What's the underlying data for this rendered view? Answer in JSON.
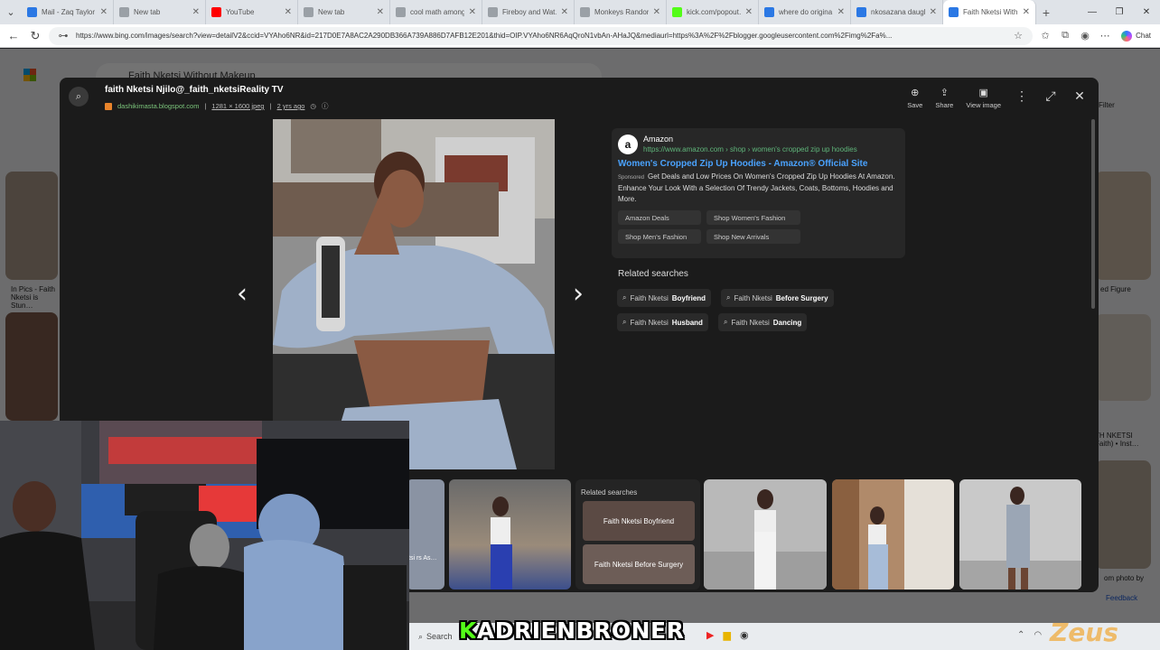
{
  "browser": {
    "tabs": [
      {
        "title": "Mail - Zaq Taylor",
        "color": "#2b78e4",
        "active": false
      },
      {
        "title": "New tab",
        "color": "#9aa0a6",
        "active": false
      },
      {
        "title": "YouTube",
        "color": "#ff0000",
        "active": false
      },
      {
        "title": "New tab",
        "color": "#9aa0a6",
        "active": false
      },
      {
        "title": "cool math among",
        "color": "#9aa0a6",
        "active": false
      },
      {
        "title": "Fireboy and Wat…",
        "color": "#9aa0a6",
        "active": false
      },
      {
        "title": "Monkeys Randon…",
        "color": "#9aa0a6",
        "active": false
      },
      {
        "title": "kick.com/popout…",
        "color": "#53fc18",
        "active": false
      },
      {
        "title": "where do origina…",
        "color": "#2b78e4",
        "active": false
      },
      {
        "title": "nkosazana daugh…",
        "color": "#2b78e4",
        "active": false
      },
      {
        "title": "Faith Nketsi With…",
        "color": "#2b78e4",
        "active": true
      }
    ],
    "url": "https://www.bing.com/images/search?view=detailV2&ccid=VYAho6NR&id=217D0E7A8AC2A290DB366A739A886D7AFB12E201&thid=OIP.VYAho6NR6AqQroN1vbAn-AHaJQ&mediaurl=https%3A%2F%2Fblogger.googleusercontent.com%2Fimg%2Fa%...",
    "chat_label": "Chat"
  },
  "background_page": {
    "search_query": "Faith Nketsi Without Makeup",
    "left_caption": "In Pics - Faith Nketsi is Stun…",
    "right_caption_1": "ed Figure",
    "right_caption_2": "TH NKETSI Faith) • Inst…",
    "right_caption_3": "om photo by",
    "feedback": "Feedback",
    "filter": "Filter"
  },
  "viewer": {
    "title": "faith Nketsi Njilo@_faith_nketsiReality TV",
    "source": "dashikimasta.blogspot.com",
    "dimensions": "1281 × 1600 jpeg",
    "age": "2 yrs ago",
    "actions": {
      "save": "Save",
      "share": "Share",
      "view_image": "View image"
    }
  },
  "ad": {
    "brand": "Amazon",
    "url": "https://www.amazon.com › shop › women's cropped zip up hoodies",
    "title": "Women's Cropped Zip Up Hoodies - Amazon® Official Site",
    "sponsored": "Sponsored",
    "description": "Get Deals and Low Prices On Women's Cropped Zip Up Hoodies At Amazon. Enhance Your Look With a Selection Of Trendy Jackets, Coats, Bottoms, Hoodies and More.",
    "links": [
      "Amazon Deals",
      "Shop Women's Fashion",
      "Shop Men's Fashion",
      "Shop New Arrivals"
    ]
  },
  "related": {
    "title": "Related searches",
    "items": [
      {
        "prefix": "Faith Nketsi",
        "bold": "Boyfriend"
      },
      {
        "prefix": "Faith Nketsi",
        "bold": "Before Surgery"
      },
      {
        "prefix": "Faith Nketsi",
        "bold": "Husband"
      },
      {
        "prefix": "Faith Nketsi",
        "bold": "Dancing"
      }
    ]
  },
  "filmstrip": {
    "related_title": "Related searches",
    "tile1": "Faith Nketsi Boyfriend",
    "tile2": "Faith Nketsi Before Surgery",
    "partial_caption": "tsi rs As…"
  },
  "overlay": {
    "streamer_prefix": "K",
    "streamer_name": "ADRIENBRONER",
    "taskbar_search": "Search",
    "zeus": "Zeus"
  }
}
